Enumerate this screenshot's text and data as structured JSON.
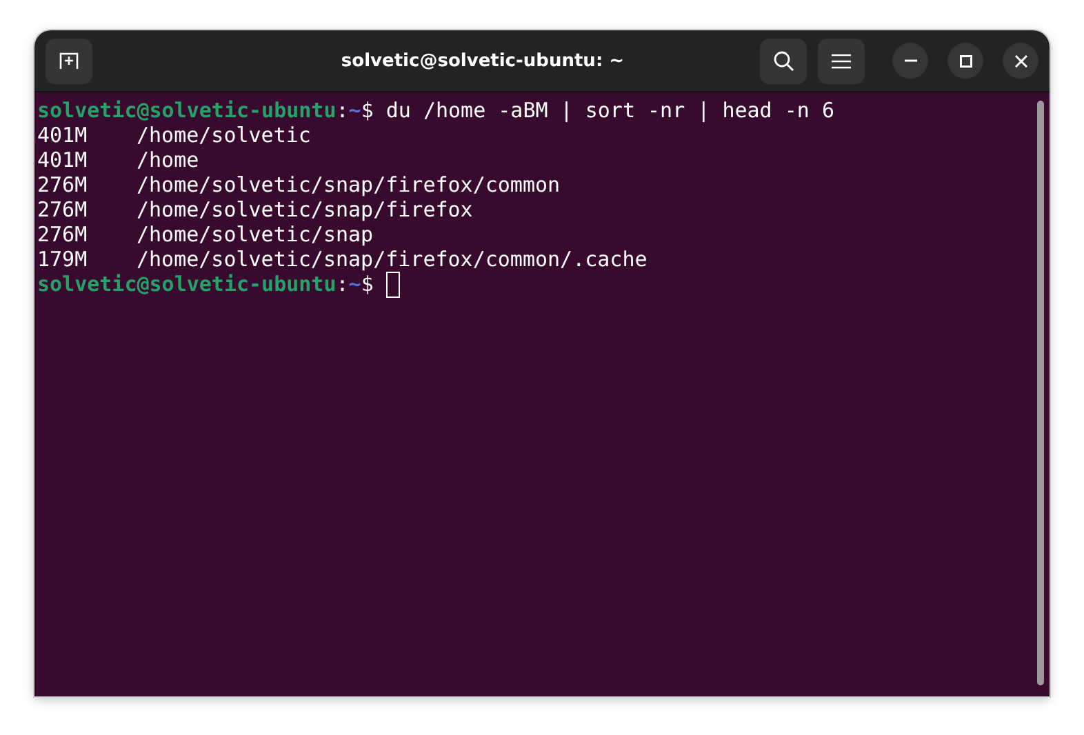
{
  "window": {
    "title": "solvetic@solvetic-ubuntu: ~"
  },
  "terminal": {
    "lines": [
      {
        "kind": "prompt",
        "user_host": "solvetic@solvetic-ubuntu",
        "separator": ":",
        "cwd": "~",
        "symbol": "$",
        "command": "du /home -aBM | sort -nr | head -n 6",
        "cursor": false
      },
      {
        "kind": "output",
        "size": "401M",
        "path": "/home/solvetic"
      },
      {
        "kind": "output",
        "size": "401M",
        "path": "/home"
      },
      {
        "kind": "output",
        "size": "276M",
        "path": "/home/solvetic/snap/firefox/common"
      },
      {
        "kind": "output",
        "size": "276M",
        "path": "/home/solvetic/snap/firefox"
      },
      {
        "kind": "output",
        "size": "276M",
        "path": "/home/solvetic/snap"
      },
      {
        "kind": "output",
        "size": "179M",
        "path": "/home/solvetic/snap/firefox/common/.cache"
      },
      {
        "kind": "prompt",
        "user_host": "solvetic@solvetic-ubuntu",
        "separator": ":",
        "cwd": "~",
        "symbol": "$",
        "cursor": true
      }
    ]
  }
}
